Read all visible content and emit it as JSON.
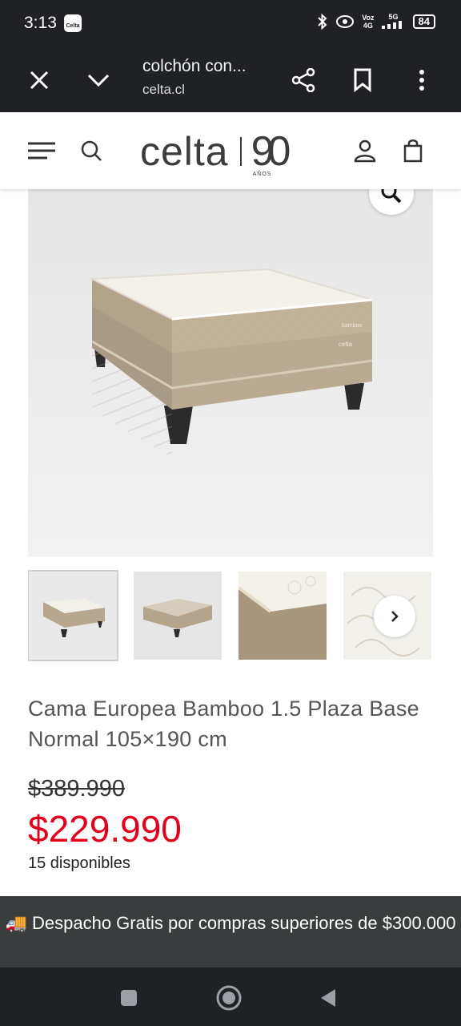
{
  "status_bar": {
    "time": "3:13",
    "app_badge": "Celta",
    "network_top": "Voz",
    "network_bottom": "4G",
    "signal_label": "5G",
    "battery": "84"
  },
  "browser": {
    "page_title": "colchón con...",
    "domain": "celta.cl",
    "icons": [
      "close-icon",
      "chevron-down-icon",
      "share-icon",
      "bookmark-icon",
      "more-vert-icon"
    ]
  },
  "site_header": {
    "logo_text": "celta",
    "logo_anniversary": "90",
    "logo_anos": "AÑOS",
    "icons": [
      "menu-icon",
      "search-icon",
      "user-icon",
      "cart-icon"
    ]
  },
  "product": {
    "title": "Cama Europea Bamboo 1.5 Plaza Base Normal 105×190 cm",
    "old_price": "$389.990",
    "price": "$229.990",
    "stock": "15 disponibles",
    "image_label_brand": "bamboo",
    "image_label_maker": "celta"
  },
  "banner": {
    "icon": "🚚",
    "text": "Despacho Gratis por compras superiores de $300.000"
  },
  "colors": {
    "chrome": "#202124",
    "price_red": "#e2001a",
    "banner_bg": "#3a3d3e"
  }
}
